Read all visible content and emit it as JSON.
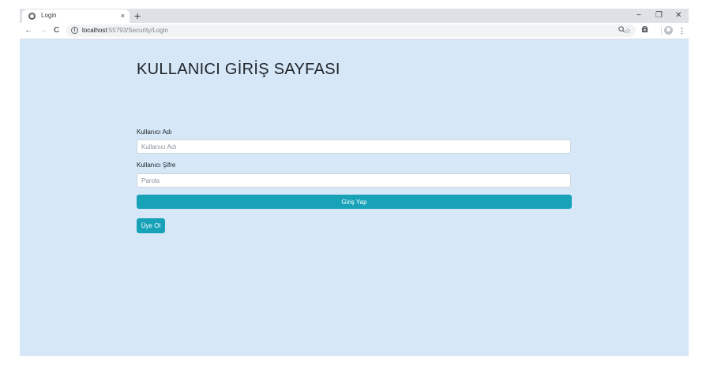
{
  "browser": {
    "tab_title": "Login",
    "tab_close": "×",
    "new_tab": "+",
    "window_controls": {
      "minimize": "−",
      "restore": "❐",
      "close": "✕"
    },
    "nav": {
      "back": "←",
      "forward": "→",
      "reload": "C"
    },
    "url_host": "localhost",
    "url_path": ":55793/Security/Login",
    "icons": [
      "zoom-icon",
      "star-icon",
      "extension-icon",
      "profile-icon",
      "menu-icon"
    ]
  },
  "page": {
    "heading": "KULLANICI GİRİŞ SAYFASI",
    "username": {
      "label": "Kullanıcı Adı",
      "placeholder": "Kullanıcı Adı",
      "value": ""
    },
    "password": {
      "label": "Kullanıcı Şifre",
      "placeholder": "Parola",
      "value": ""
    },
    "login_button": "Giriş Yap",
    "signup_button": "Üye Ol"
  },
  "colors": {
    "page_background": "#d6e7f7",
    "button": "#17a2b8",
    "tabstrip": "#dee1e6"
  }
}
